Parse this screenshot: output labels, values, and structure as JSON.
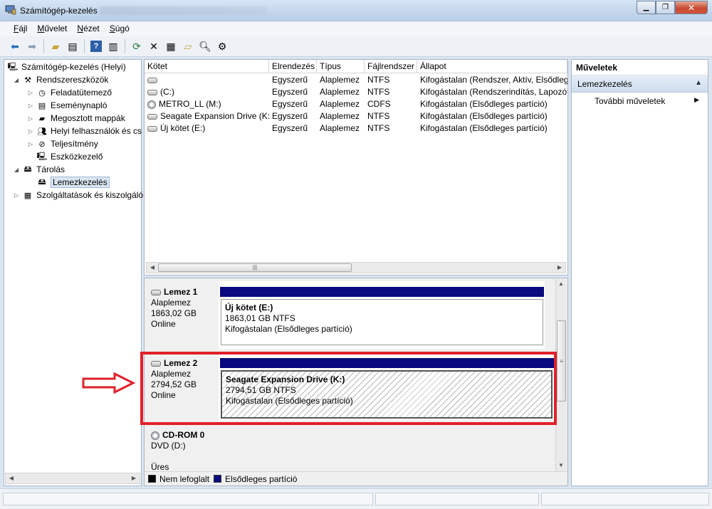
{
  "window": {
    "title": "Számítógép-kezelés"
  },
  "menu": {
    "items": [
      {
        "label": "Fájl",
        "accel": "F",
        "rest": "ájl"
      },
      {
        "label": "Művelet",
        "accel": "M",
        "rest": "űvelet"
      },
      {
        "label": "Nézet",
        "accel": "N",
        "rest": "ézet"
      },
      {
        "label": "Súgó",
        "accel": "S",
        "rest": "úgó"
      }
    ]
  },
  "tree": {
    "root": "Számítógép-kezelés (Helyi)",
    "system_tools": "Rendszereszközök",
    "task_scheduler": "Feladatütemező",
    "event_viewer": "Eseménynapló",
    "shared_folders": "Megosztott mappák",
    "local_users": "Helyi felhasználók és cs",
    "performance": "Teljesítmény",
    "device_manager": "Eszközkezelő",
    "storage": "Tárolás",
    "disk_mgmt": "Lemezkezelés",
    "services": "Szolgáltatások és kiszolgáló"
  },
  "table": {
    "headers": [
      "Kötet",
      "Elrendezés",
      "Típus",
      "Fájlrendszer",
      "Állapot"
    ],
    "rows": [
      [
        "",
        "Egyszerű",
        "Alaplemez",
        "NTFS",
        "Kifogástalan (Rendszer, Aktív, Elsődleges"
      ],
      [
        "(C:)",
        "Egyszerű",
        "Alaplemez",
        "NTFS",
        "Kifogástalan (Rendszerindítás, Lapozófá"
      ],
      [
        "METRO_LL (M:)",
        "Egyszerű",
        "Alaplemez",
        "CDFS",
        "Kifogástalan (Elsődleges partíció)"
      ],
      [
        "Seagate Expansion Drive (K:)",
        "Egyszerű",
        "Alaplemez",
        "NTFS",
        "Kifogástalan (Elsődleges partíció)"
      ],
      [
        "Új kötet (E:)",
        "Egyszerű",
        "Alaplemez",
        "NTFS",
        "Kifogástalan (Elsődleges partíció)"
      ]
    ]
  },
  "disks": [
    {
      "name": "Lemez 1",
      "type": "Alaplemez",
      "size": "1863,02 GB",
      "status": "Online",
      "volume": {
        "title": "Új kötet  (E:)",
        "size": "1863,01 GB NTFS",
        "status": "Kifogástalan (Elsődleges partíció)"
      }
    },
    {
      "name": "Lemez 2",
      "type": "Alaplemez",
      "size": "2794,52 GB",
      "status": "Online",
      "volume": {
        "title": "Seagate Expansion Drive  (K:)",
        "size": "2794,51 GB NTFS",
        "status": "Kifogástalan (Elsődleges partíció)"
      }
    },
    {
      "name": "CD-ROM 0",
      "type": "DVD (D:)",
      "status": "Üres"
    }
  ],
  "legend": {
    "unallocated": "Nem lefoglalt",
    "primary": "Elsődleges partíció"
  },
  "actions": {
    "header": "Műveletek",
    "group": "Lemezkezelés",
    "more": "További műveletek"
  },
  "colors": {
    "partition_bar": "#0a0a7e",
    "highlight": "#e1202a"
  }
}
